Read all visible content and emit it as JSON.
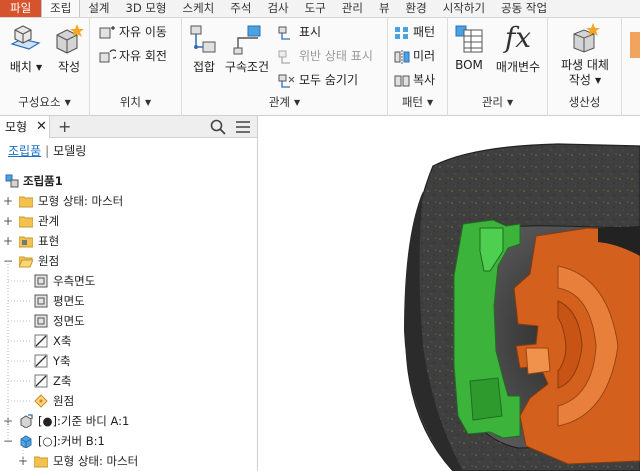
{
  "tabs": [
    "파일",
    "조립",
    "설계",
    "3D 모형",
    "스케치",
    "주석",
    "검사",
    "도구",
    "관리",
    "뷰",
    "환경",
    "시작하기",
    "공동 작업"
  ],
  "ribbon": {
    "component_panel": {
      "title": "구성요소",
      "place": "배치",
      "create": "작성"
    },
    "position_panel": {
      "title": "위치",
      "free_move": "자유 이동",
      "free_rotate": "자유 회전"
    },
    "relationships_panel": {
      "title": "관계",
      "joint": "접합",
      "constrain": "구속조건",
      "show": "표시",
      "show_sick": "위반 상태 표시",
      "hide_all": "모두 숨기기"
    },
    "pattern_panel": {
      "title": "패턴",
      "pattern": "패턴",
      "mirror": "미러",
      "copy": "복사"
    },
    "manage_panel": {
      "title": "관리",
      "bom": "BOM",
      "parameters": "매개변수"
    },
    "productivity_panel": {
      "title": "생산성",
      "derive_line1": "파생 대체",
      "derive_line2": "작성"
    }
  },
  "browser": {
    "tab_label": "모형",
    "mode_assembly": "조립품",
    "mode_modeling": "모델링",
    "tree": [
      {
        "label": "조립품1",
        "bold": true
      },
      {
        "label": "모형 상태: 마스터"
      },
      {
        "label": "관계"
      },
      {
        "label": "표현"
      },
      {
        "label": "원점"
      },
      {
        "label": "우측면도"
      },
      {
        "label": "평면도"
      },
      {
        "label": "정면도"
      },
      {
        "label": "X축"
      },
      {
        "label": "Y축"
      },
      {
        "label": "Z축"
      },
      {
        "label": "원점"
      },
      {
        "label": "[●]:기준 바디 A:1"
      },
      {
        "label": "[○]:커버 B:1"
      },
      {
        "label": "모형 상태: 마스터"
      }
    ]
  },
  "colors": {
    "file_tab": "#d6542d",
    "accent_blue": "#1b6fc2",
    "part_green": "#3cb43c",
    "part_orange": "#d4601e",
    "housing_dark": "#3c3c3c"
  }
}
